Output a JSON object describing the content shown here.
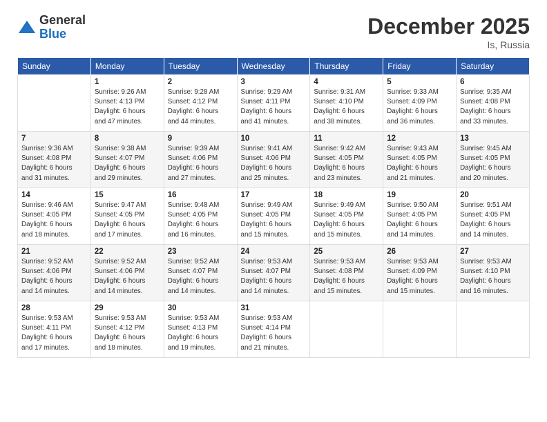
{
  "logo": {
    "general": "General",
    "blue": "Blue"
  },
  "header": {
    "month_year": "December 2025",
    "location": "Is, Russia"
  },
  "weekdays": [
    "Sunday",
    "Monday",
    "Tuesday",
    "Wednesday",
    "Thursday",
    "Friday",
    "Saturday"
  ],
  "weeks": [
    [
      {
        "day": "",
        "info": ""
      },
      {
        "day": "1",
        "info": "Sunrise: 9:26 AM\nSunset: 4:13 PM\nDaylight: 6 hours\nand 47 minutes."
      },
      {
        "day": "2",
        "info": "Sunrise: 9:28 AM\nSunset: 4:12 PM\nDaylight: 6 hours\nand 44 minutes."
      },
      {
        "day": "3",
        "info": "Sunrise: 9:29 AM\nSunset: 4:11 PM\nDaylight: 6 hours\nand 41 minutes."
      },
      {
        "day": "4",
        "info": "Sunrise: 9:31 AM\nSunset: 4:10 PM\nDaylight: 6 hours\nand 38 minutes."
      },
      {
        "day": "5",
        "info": "Sunrise: 9:33 AM\nSunset: 4:09 PM\nDaylight: 6 hours\nand 36 minutes."
      },
      {
        "day": "6",
        "info": "Sunrise: 9:35 AM\nSunset: 4:08 PM\nDaylight: 6 hours\nand 33 minutes."
      }
    ],
    [
      {
        "day": "7",
        "info": "Sunrise: 9:36 AM\nSunset: 4:08 PM\nDaylight: 6 hours\nand 31 minutes."
      },
      {
        "day": "8",
        "info": "Sunrise: 9:38 AM\nSunset: 4:07 PM\nDaylight: 6 hours\nand 29 minutes."
      },
      {
        "day": "9",
        "info": "Sunrise: 9:39 AM\nSunset: 4:06 PM\nDaylight: 6 hours\nand 27 minutes."
      },
      {
        "day": "10",
        "info": "Sunrise: 9:41 AM\nSunset: 4:06 PM\nDaylight: 6 hours\nand 25 minutes."
      },
      {
        "day": "11",
        "info": "Sunrise: 9:42 AM\nSunset: 4:05 PM\nDaylight: 6 hours\nand 23 minutes."
      },
      {
        "day": "12",
        "info": "Sunrise: 9:43 AM\nSunset: 4:05 PM\nDaylight: 6 hours\nand 21 minutes."
      },
      {
        "day": "13",
        "info": "Sunrise: 9:45 AM\nSunset: 4:05 PM\nDaylight: 6 hours\nand 20 minutes."
      }
    ],
    [
      {
        "day": "14",
        "info": "Sunrise: 9:46 AM\nSunset: 4:05 PM\nDaylight: 6 hours\nand 18 minutes."
      },
      {
        "day": "15",
        "info": "Sunrise: 9:47 AM\nSunset: 4:05 PM\nDaylight: 6 hours\nand 17 minutes."
      },
      {
        "day": "16",
        "info": "Sunrise: 9:48 AM\nSunset: 4:05 PM\nDaylight: 6 hours\nand 16 minutes."
      },
      {
        "day": "17",
        "info": "Sunrise: 9:49 AM\nSunset: 4:05 PM\nDaylight: 6 hours\nand 15 minutes."
      },
      {
        "day": "18",
        "info": "Sunrise: 9:49 AM\nSunset: 4:05 PM\nDaylight: 6 hours\nand 15 minutes."
      },
      {
        "day": "19",
        "info": "Sunrise: 9:50 AM\nSunset: 4:05 PM\nDaylight: 6 hours\nand 14 minutes."
      },
      {
        "day": "20",
        "info": "Sunrise: 9:51 AM\nSunset: 4:05 PM\nDaylight: 6 hours\nand 14 minutes."
      }
    ],
    [
      {
        "day": "21",
        "info": "Sunrise: 9:52 AM\nSunset: 4:06 PM\nDaylight: 6 hours\nand 14 minutes."
      },
      {
        "day": "22",
        "info": "Sunrise: 9:52 AM\nSunset: 4:06 PM\nDaylight: 6 hours\nand 14 minutes."
      },
      {
        "day": "23",
        "info": "Sunrise: 9:52 AM\nSunset: 4:07 PM\nDaylight: 6 hours\nand 14 minutes."
      },
      {
        "day": "24",
        "info": "Sunrise: 9:53 AM\nSunset: 4:07 PM\nDaylight: 6 hours\nand 14 minutes."
      },
      {
        "day": "25",
        "info": "Sunrise: 9:53 AM\nSunset: 4:08 PM\nDaylight: 6 hours\nand 15 minutes."
      },
      {
        "day": "26",
        "info": "Sunrise: 9:53 AM\nSunset: 4:09 PM\nDaylight: 6 hours\nand 15 minutes."
      },
      {
        "day": "27",
        "info": "Sunrise: 9:53 AM\nSunset: 4:10 PM\nDaylight: 6 hours\nand 16 minutes."
      }
    ],
    [
      {
        "day": "28",
        "info": "Sunrise: 9:53 AM\nSunset: 4:11 PM\nDaylight: 6 hours\nand 17 minutes."
      },
      {
        "day": "29",
        "info": "Sunrise: 9:53 AM\nSunset: 4:12 PM\nDaylight: 6 hours\nand 18 minutes."
      },
      {
        "day": "30",
        "info": "Sunrise: 9:53 AM\nSunset: 4:13 PM\nDaylight: 6 hours\nand 19 minutes."
      },
      {
        "day": "31",
        "info": "Sunrise: 9:53 AM\nSunset: 4:14 PM\nDaylight: 6 hours\nand 21 minutes."
      },
      {
        "day": "",
        "info": ""
      },
      {
        "day": "",
        "info": ""
      },
      {
        "day": "",
        "info": ""
      }
    ]
  ]
}
